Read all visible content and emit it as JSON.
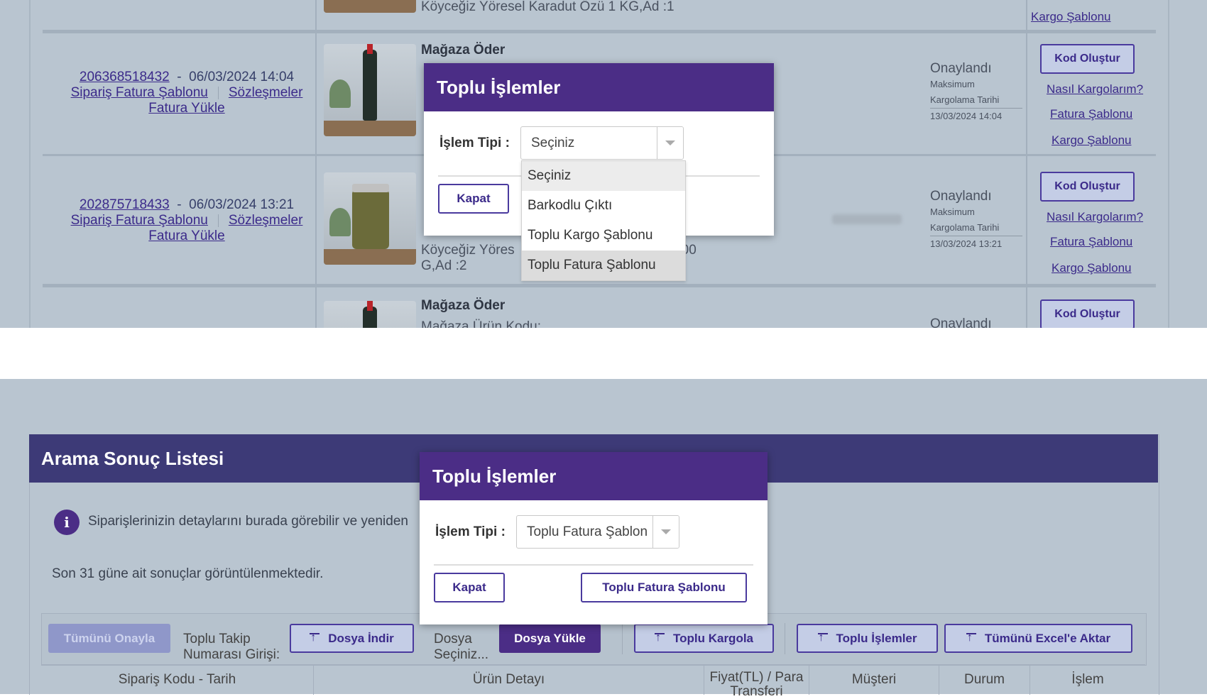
{
  "top": {
    "partial_row": {
      "product_text": "Köyceğiz Yöresel Karadut Özü 1 KG,Ad :1",
      "action_link": "Kargo Şablonu"
    },
    "rows": [
      {
        "order_code": "206368518432",
        "date": "06/03/2024 14:04",
        "invoice_template": "Sipariş Fatura Şablonu",
        "contracts": "Sözleşmeler",
        "upload_invoice": "Fatura Yükle",
        "store": "Mağaza Öder",
        "status": "Onaylandı",
        "max_label": "Maksimum",
        "cargo_date_label": "Kargolama Tarihi",
        "cargo_date": "13/03/2024 14:04",
        "btn_code": "Kod Oluştur",
        "link_how": "Nasıl Kargolarım?",
        "link_invoice": "Fatura Şablonu",
        "link_cargo": "Kargo Şablonu"
      },
      {
        "order_code": "202875718433",
        "date": "06/03/2024 13:21",
        "invoice_template": "Sipariş Fatura Şablonu",
        "contracts": "Sözleşmeler",
        "upload_invoice": "Fatura Yükle",
        "product_line1": "Köyceğiz Yöres",
        "product_line1_tail": "00",
        "product_line2": "G,Ad :2",
        "status": "Onaylandı",
        "max_label": "Maksimum",
        "cargo_date_label": "Kargolama Tarihi",
        "cargo_date": "13/03/2024 13:21",
        "btn_code": "Kod Oluştur",
        "link_how": "Nasıl Kargolarım?",
        "link_invoice": "Fatura Şablonu",
        "link_cargo": "Kargo Şablonu"
      },
      {
        "store": "Mağaza Öder",
        "store_code": "Mağaza Ürün Kodu:",
        "status": "Onaylandı",
        "btn_code": "Kod Oluştur"
      }
    ],
    "modal": {
      "title": "Toplu İşlemler",
      "label": "İşlem Tipi :",
      "selected": "Seçiniz",
      "close": "Kapat",
      "options": [
        "Seçiniz",
        "Barkodlu Çıktı",
        "Toplu Kargo Şablonu",
        "Toplu Fatura Şablonu"
      ]
    }
  },
  "bottom": {
    "header": "Arama Sonuç Listesi",
    "info": "Siparişlerinizin detaylarını burada görebilir ve yeniden",
    "period": "Son 31 güne ait sonuçlar görüntülenmektedir.",
    "toolbar": {
      "approve_all": "Tümünü Onayla",
      "bulk_tracking": "Toplu Takip Numarası Girişi:",
      "download": "Dosya İndir",
      "choose_file": "Dosya Seçiniz...",
      "upload": "Dosya Yükle",
      "bulk_ship": "Toplu Kargola",
      "bulk_ops": "Toplu İşlemler",
      "export_all": "Tümünü Excel'e Aktar"
    },
    "columns": [
      "Sipariş Kodu - Tarih",
      "Ürün Detayı",
      "Fiyat(TL) / Para Transferi",
      "Müşteri",
      "Durum",
      "İşlem"
    ],
    "modal": {
      "title": "Toplu İşlemler",
      "label": "İşlem Tipi :",
      "selected": "Toplu Fatura Şablon",
      "close": "Kapat",
      "action": "Toplu Fatura Şablonu"
    }
  }
}
